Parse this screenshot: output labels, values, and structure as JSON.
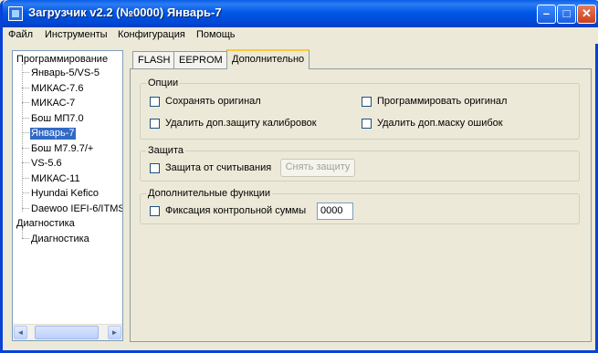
{
  "window": {
    "title": "Загрузчик v2.2 (№0000) Январь-7",
    "min_glyph": "–",
    "max_glyph": "□",
    "close_glyph": "✕"
  },
  "menu": [
    "Файл",
    "Инструменты",
    "Конфигурация",
    "Помощь"
  ],
  "tree": {
    "root1": "Программирование",
    "items": [
      "Январь-5/VS-5",
      "МИКАС-7.6",
      "МИКАС-7",
      "Бош МП7.0",
      "Январь-7",
      "Бош М7.9.7/+",
      "VS-5.6",
      "МИКАС-11",
      "Hyundai Kefico",
      "Daewoo IEFI-6/ITMS"
    ],
    "selected_index": 4,
    "root2": "Диагностика",
    "sub2": "Диагностика",
    "scroll_left": "◄",
    "scroll_right": "►"
  },
  "tabs": [
    "FLASH",
    "EEPROM",
    "Дополнительно"
  ],
  "active_tab": "Дополнительно",
  "options": {
    "title": "Опции",
    "save_original": "Сохранять оригинал",
    "program_original": "Программировать оригинал",
    "remove_calib_protection": "Удалить доп.защиту калибровок",
    "remove_error_mask": "Удалить доп.маску ошибок"
  },
  "protection": {
    "title": "Защита",
    "read_protection": "Защита от считывания",
    "remove_button": "Снять защиту"
  },
  "extra": {
    "title": "Дополнительные функции",
    "checksum_fix": "Фиксация контрольной суммы",
    "checksum_value": "0000"
  }
}
